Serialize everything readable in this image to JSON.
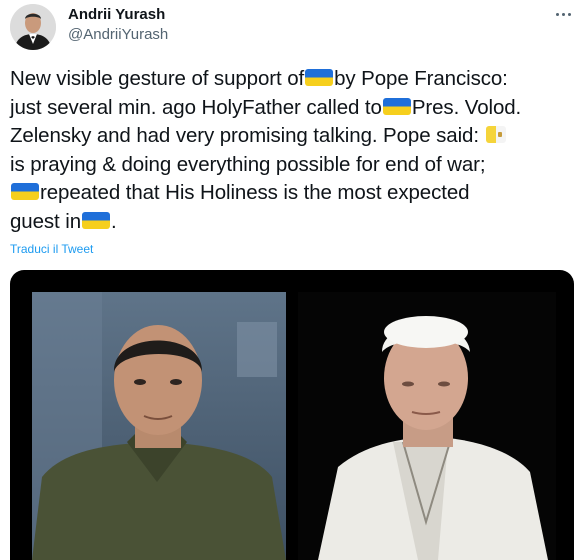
{
  "tweet": {
    "author": {
      "name": "Andrii Yurash",
      "handle": "@AndriiYurash"
    },
    "text": {
      "line1_a": "New visible gesture of support of",
      "line1_b": "by Pope Francisco:",
      "line2_a": "just several min. ago HolyFather called to",
      "line2_b": "Pres. Volod.",
      "line3": "Zelensky and had very promising talking. Pope said:",
      "line4": "is praying & doing everything possible for end of war;",
      "line5": "repeated that His Holiness is the most expected",
      "line6_a": "guest in",
      "line6_b": "."
    },
    "flags": {
      "ukraine": "ukraine-flag-icon",
      "vatican": "vatican-flag-icon"
    },
    "translate_label": "Traduci il Tweet",
    "colors": {
      "link": "#1d9bf0",
      "secondary_text": "#536471",
      "primary_text": "#0f1419"
    }
  }
}
